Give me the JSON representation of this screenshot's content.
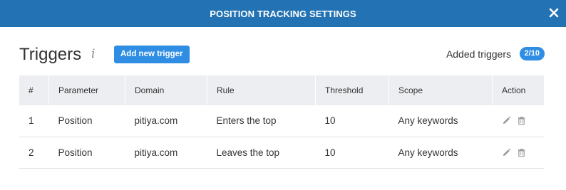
{
  "header": {
    "title": "POSITION TRACKING SETTINGS",
    "close_icon": "close-icon"
  },
  "triggers": {
    "title": "Triggers",
    "info_icon": "i",
    "add_button": "Add new trigger",
    "added_label": "Added triggers",
    "added_count": "2/10"
  },
  "table": {
    "columns": [
      "#",
      "Parameter",
      "Domain",
      "Rule",
      "Threshold",
      "Scope",
      "Action"
    ],
    "rows": [
      {
        "num": "1",
        "parameter": "Position",
        "domain": "pitiya.com",
        "rule": "Enters the top",
        "threshold": "10",
        "scope": "Any keywords"
      },
      {
        "num": "2",
        "parameter": "Position",
        "domain": "pitiya.com",
        "rule": "Leaves the top",
        "threshold": "10",
        "scope": "Any keywords"
      }
    ]
  },
  "colors": {
    "header_bg": "#2272b4",
    "accent": "#2f8de4",
    "table_header_bg": "#eceef1"
  }
}
